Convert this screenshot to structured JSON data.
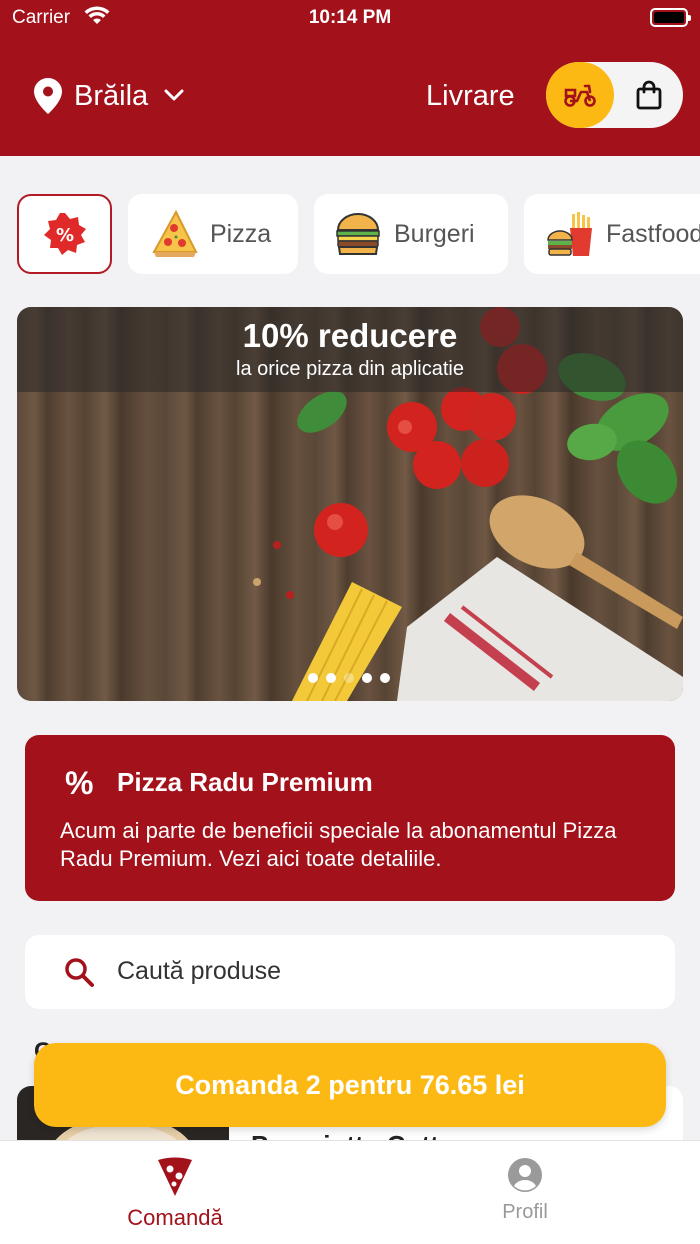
{
  "status_bar": {
    "carrier": "Carrier",
    "time": "10:14 PM"
  },
  "header": {
    "city": "Brăila",
    "mode_label": "Livrare",
    "icons": [
      "location-pin-icon",
      "chevron-down-icon",
      "scooter-icon",
      "shopping-bag-icon"
    ]
  },
  "categories": [
    {
      "label": "",
      "icon": "discount-badge-icon"
    },
    {
      "label": "Pizza",
      "icon": "pizza-slice-icon"
    },
    {
      "label": "Burgeri",
      "icon": "burger-icon"
    },
    {
      "label": "Fastfood",
      "icon": "fastfood-icon"
    }
  ],
  "banner": {
    "title": "10% reducere",
    "subtitle": "la orice pizza din aplicatie",
    "slides": 5,
    "active_slide": 1
  },
  "premium": {
    "icon": "%",
    "title": "Pizza Radu Premium",
    "description": "Acum ai parte de beneficii speciale la abonamentul Pizza Radu Premium. Vezi aici toate detaliile."
  },
  "search": {
    "placeholder": "Caută produse"
  },
  "section_peek": {
    "title": "C"
  },
  "product_peek": {
    "name": "Prosciutto Cotto"
  },
  "order_button": {
    "label": "Comanda 2 pentru 76.65 lei"
  },
  "tabs": [
    {
      "label": "Comandă",
      "icon": "pizza-slice-icon",
      "active": true
    },
    {
      "label": "Profil",
      "icon": "user-circle-icon",
      "active": false
    }
  ],
  "colors": {
    "brand": "#a3111b",
    "accent": "#fdb913",
    "background": "#f2f2f4"
  }
}
